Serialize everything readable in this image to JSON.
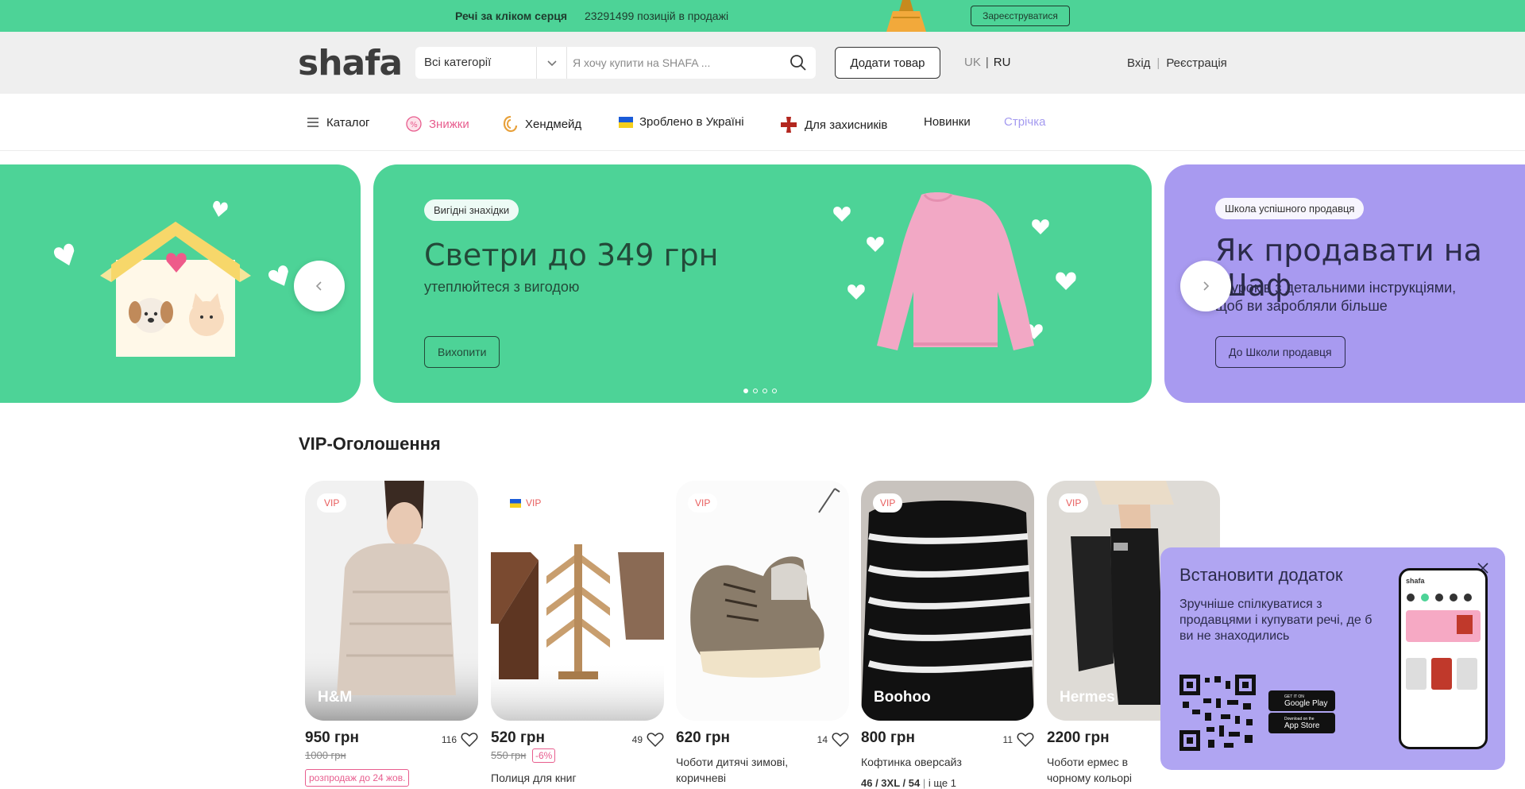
{
  "topbar": {
    "promo": "Речі за кліком серця",
    "count": "23291499 позицій в продажі",
    "register_button": "Зареєструватися",
    "color": "#4dd397"
  },
  "header": {
    "logo": "shafa",
    "category_select": "Всі категорії",
    "search_placeholder": "Я хочу купити на SHAFA ...",
    "add_button": "Додати товар",
    "lang_uk": "UK",
    "lang_ru": "RU",
    "login": "Вхід",
    "signup": "Реєстрація"
  },
  "nav": {
    "catalog": "Каталог",
    "discounts": "Знижки",
    "handmade": "Хендмейд",
    "ukraine": "Зроблено в Україні",
    "defenders": "Для захисників",
    "new": "Новинки",
    "feed": "Стрічка"
  },
  "banners": {
    "middle": {
      "pill": "Вигідні знахідки",
      "title": "Светри до 349 грн",
      "subtitle": "утеплюйтеся з вигодою",
      "button": "Вихопити"
    },
    "right": {
      "pill": "Школа успішного продавця",
      "title": "Як продавати на Шаф",
      "subtitle_line1": "уроків з детальними інструкціями,",
      "subtitle_line2": "щоб ви заробляли більше",
      "button": "До Школи продавця"
    },
    "slides_count": 4,
    "active_slide": 1
  },
  "vip": {
    "section_title": "VIP-Оголошення",
    "badge": "VIP",
    "cards": [
      {
        "brand": "H&M",
        "price": "950 грн",
        "old_price": "1000 грн",
        "likes": "116",
        "tag": "розпродаж до 24 жов."
      },
      {
        "brand": "",
        "price": "520 грн",
        "old_price": "550 грн",
        "discount": "-6%",
        "likes": "49",
        "title": "Полиця для книг"
      },
      {
        "brand": "",
        "price": "620 грн",
        "likes": "14",
        "title": "Чоботи дитячі зимові, коричневі"
      },
      {
        "brand": "Boohoo",
        "price": "800 грн",
        "likes": "11",
        "title": "Кофтинка оверсайз",
        "sizes": "46 / 3XL / 54",
        "sizes_more": "і ще 1"
      },
      {
        "brand": "Hermes",
        "price": "2200 грн",
        "title": "Чоботи ермес в чорному кольорі"
      }
    ]
  },
  "app_popup": {
    "title": "Встановити додаток",
    "description": "Зручніше спілкуватися з продавцями і купувати речі, де б ви не знаходились",
    "google_small": "GET IT ON",
    "google_big": "Google Play",
    "apple_small": "Download on the",
    "apple_big": "App Store",
    "phone_logo": "shafa"
  }
}
